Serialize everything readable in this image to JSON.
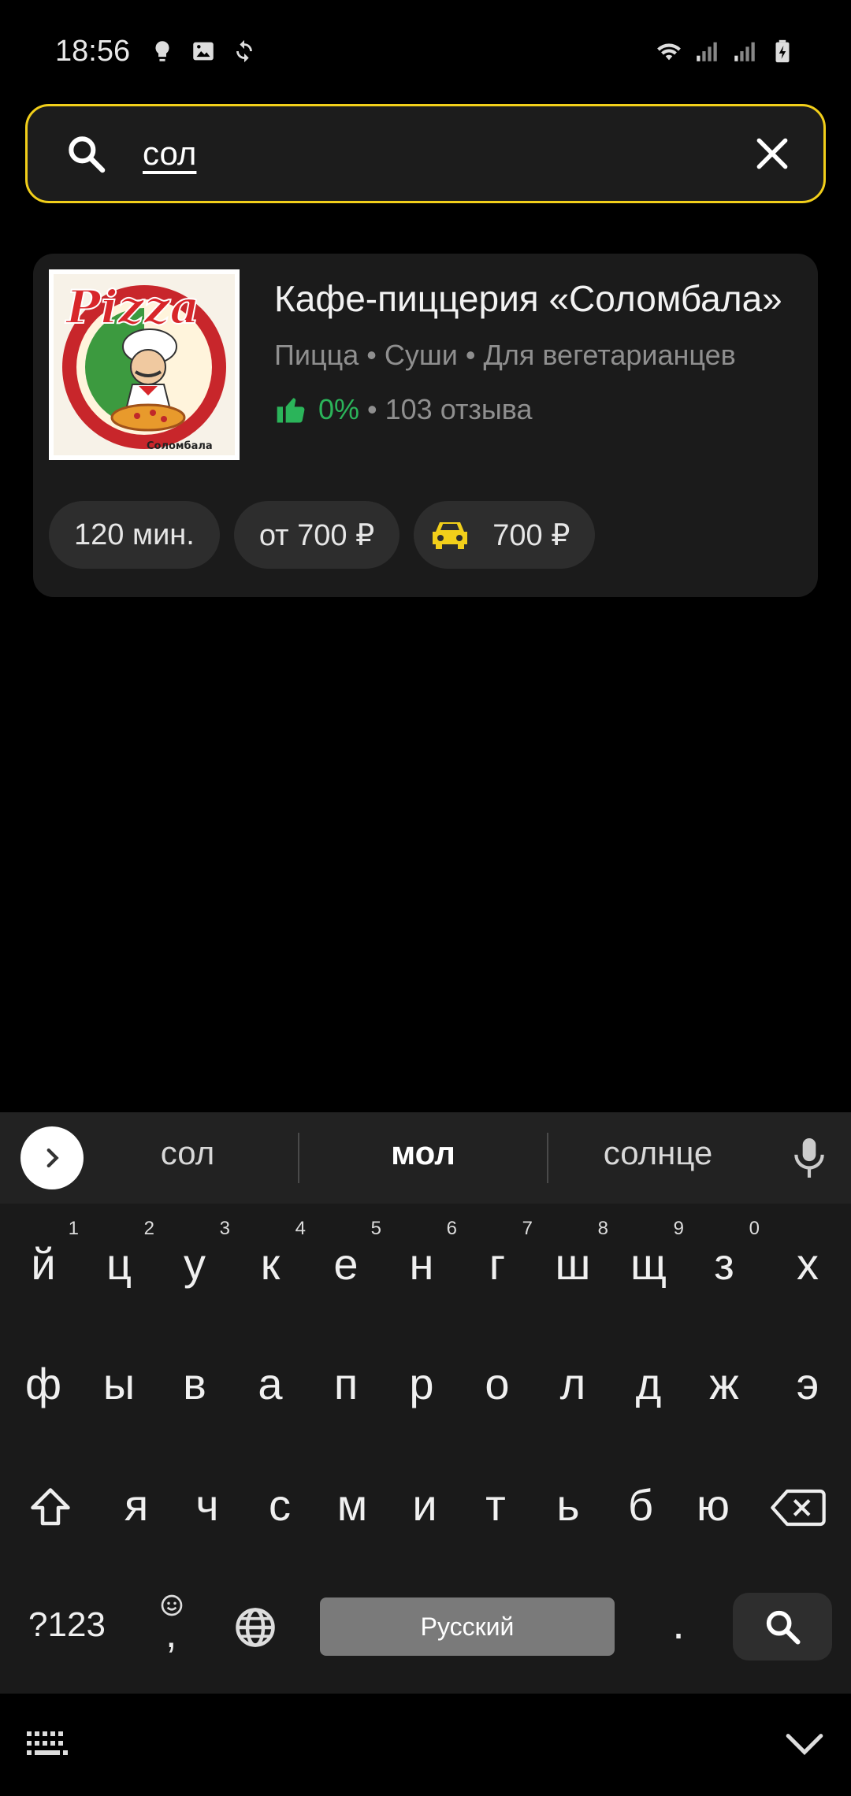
{
  "status_bar": {
    "time": "18:56",
    "left_icons": [
      "bulb-icon",
      "image-icon",
      "sync-icon"
    ],
    "right_icons": [
      "wifi-icon",
      "signal-icon",
      "signal-icon",
      "battery-charging-icon"
    ]
  },
  "search": {
    "value": "сол",
    "accent_color": "#f2cf1a"
  },
  "result_card": {
    "logo_text": "Pizza",
    "logo_caption": "Соломбала",
    "title": "Кафе-пиццерия «Соломбала»",
    "tags": "Пицца • Суши • Для вегетарианцев",
    "rating_percent": "0%",
    "rating_separator": "•",
    "reviews": "103 отзыва",
    "rating_color": "#2bb45a",
    "chips": {
      "time": "120 мин.",
      "min_order": "от 700 ₽",
      "delivery_price": "700 ₽"
    }
  },
  "keyboard": {
    "suggestions": [
      "сол",
      "мол",
      "солнце"
    ],
    "row1": [
      {
        "k": "й",
        "n": "1"
      },
      {
        "k": "ц",
        "n": "2"
      },
      {
        "k": "у",
        "n": "3"
      },
      {
        "k": "к",
        "n": "4"
      },
      {
        "k": "е",
        "n": "5"
      },
      {
        "k": "н",
        "n": "6"
      },
      {
        "k": "г",
        "n": "7"
      },
      {
        "k": "ш",
        "n": "8"
      },
      {
        "k": "щ",
        "n": "9"
      },
      {
        "k": "з",
        "n": "0"
      },
      {
        "k": "х",
        "n": ""
      }
    ],
    "row2": [
      "ф",
      "ы",
      "в",
      "а",
      "п",
      "р",
      "о",
      "л",
      "д",
      "ж",
      "э"
    ],
    "row3": [
      "я",
      "ч",
      "с",
      "м",
      "и",
      "т",
      "ь",
      "б",
      "ю"
    ],
    "symbols_label": "?123",
    "comma": ",",
    "space_label": "Русский",
    "period": "."
  }
}
